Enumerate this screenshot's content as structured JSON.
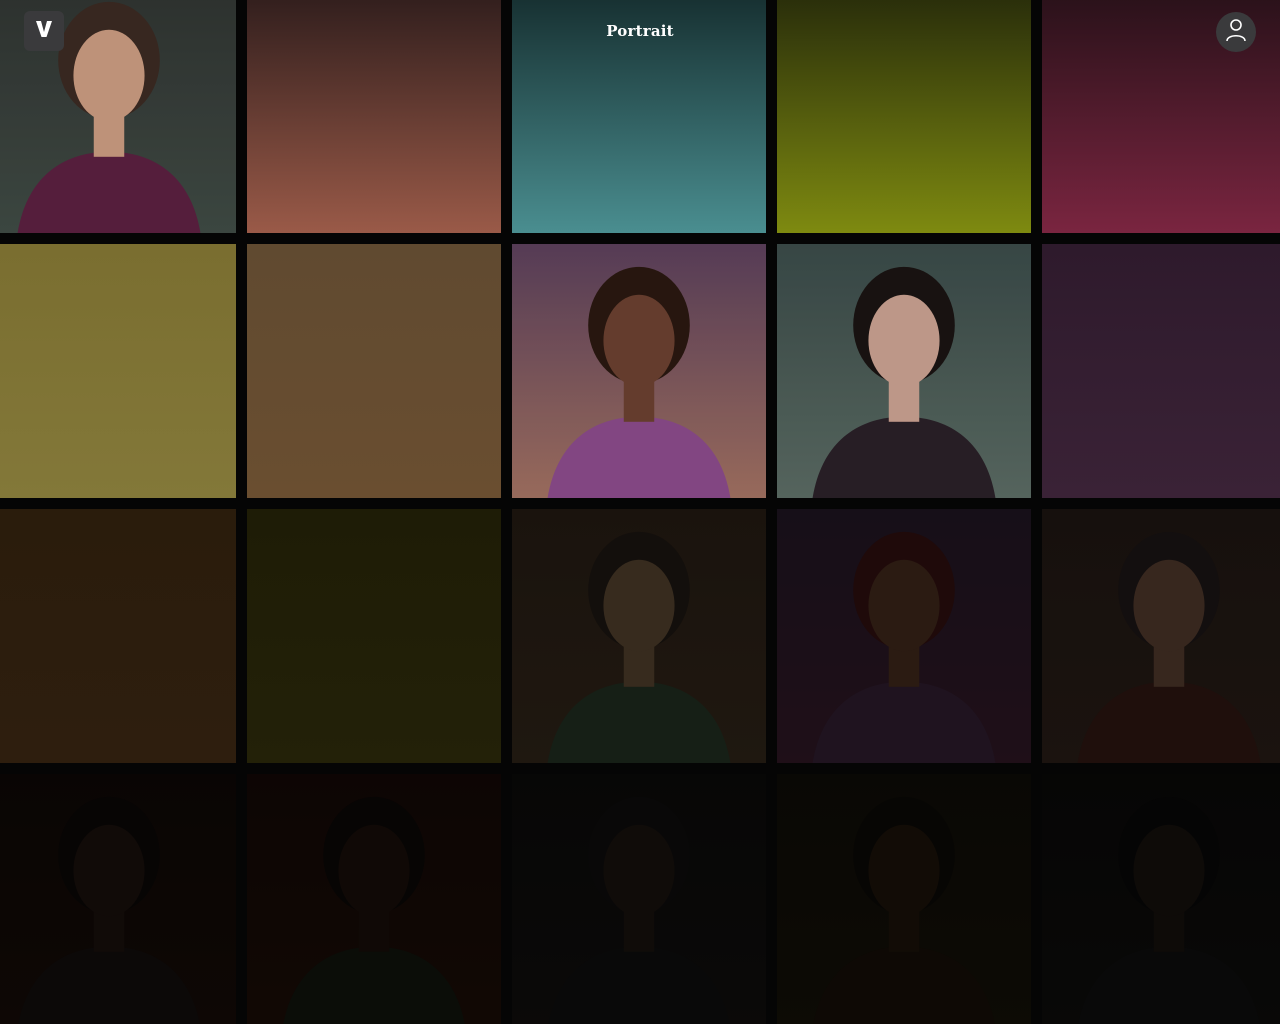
{
  "app": {
    "title": "Portrait",
    "logo_icon": "brand-v-logo-icon",
    "avatar_icon": "user-icon"
  },
  "gallery": {
    "tiles": [
      {
        "name": "portrait-woman-green",
        "kind": "portrait",
        "colors": [
          "#2f3330",
          "#3f4a44"
        ],
        "skin": "#c99a80",
        "hair": "#3a2a22",
        "cloth": "#5a2040",
        "dim": 0.05
      },
      {
        "name": "placeholder-salmon",
        "kind": "gradient",
        "colors": [
          "#2a1a1a",
          "#9a5a48"
        ],
        "dim": 0.0
      },
      {
        "name": "placeholder-teal",
        "kind": "gradient",
        "colors": [
          "#13292a",
          "#4a8e90"
        ],
        "dim": 0.0
      },
      {
        "name": "placeholder-olive",
        "kind": "gradient",
        "colors": [
          "#23270a",
          "#7e8a10"
        ],
        "dim": 0.0
      },
      {
        "name": "placeholder-crimson",
        "kind": "gradient",
        "colors": [
          "#241017",
          "#7a2540"
        ],
        "dim": 0.0
      },
      {
        "name": "placeholder-mustard",
        "kind": "gradient",
        "colors": [
          "#7a6e30",
          "#837839"
        ],
        "dim": 0.0
      },
      {
        "name": "placeholder-brown",
        "kind": "gradient",
        "colors": [
          "#604a30",
          "#6a4e30"
        ],
        "dim": 0.0
      },
      {
        "name": "portrait-hat-woman",
        "kind": "portrait",
        "colors": [
          "#5a3f5a",
          "#a07060"
        ],
        "skin": "#6a4030",
        "hair": "#2a1810",
        "cloth": "#8a4a8a",
        "dim": 0.05
      },
      {
        "name": "portrait-asian-woman",
        "kind": "portrait",
        "colors": [
          "#3a4a48",
          "#5a6a62"
        ],
        "skin": "#c8a090",
        "hair": "#1a1412",
        "cloth": "#2a2028",
        "dim": 0.05
      },
      {
        "name": "placeholder-plum",
        "kind": "gradient",
        "colors": [
          "#2e1a2c",
          "#3a2236"
        ],
        "dim": 0.0
      },
      {
        "name": "placeholder-dark-brown",
        "kind": "gradient",
        "colors": [
          "#2a1c0c",
          "#2e1e0e"
        ],
        "dim": 0.0
      },
      {
        "name": "placeholder-dark-olive",
        "kind": "gradient",
        "colors": [
          "#1e1c06",
          "#232108"
        ],
        "dim": 0.0
      },
      {
        "name": "portrait-man-glasses",
        "kind": "portrait",
        "colors": [
          "#231a12",
          "#2a2016"
        ],
        "skin": "#4a3a28",
        "hair": "#1a1410",
        "cloth": "#1e2a1e",
        "dim": 0.25
      },
      {
        "name": "portrait-man-red",
        "kind": "portrait",
        "colors": [
          "#1e1420",
          "#2a1420"
        ],
        "skin": "#3a2418",
        "hair": "#2a0e0e",
        "cloth": "#2a1a2a",
        "dim": 0.25
      },
      {
        "name": "portrait-woman-jacket",
        "kind": "portrait",
        "colors": [
          "#1e1612",
          "#241a14"
        ],
        "skin": "#4a3428",
        "hair": "#1a1414",
        "cloth": "#2a1410",
        "dim": 0.25
      },
      {
        "name": "portrait-man-dark-1",
        "kind": "portrait",
        "colors": [
          "#120a08",
          "#1a0e0a"
        ],
        "skin": "#201410",
        "hair": "#0e0a08",
        "cloth": "#161210",
        "dim": 0.45
      },
      {
        "name": "portrait-fighter-red",
        "kind": "portrait",
        "colors": [
          "#180a08",
          "#201008"
        ],
        "skin": "#1e120c",
        "hair": "#0e0a08",
        "cloth": "#141810",
        "dim": 0.45
      },
      {
        "name": "portrait-helmet",
        "kind": "portrait",
        "colors": [
          "#0e0d0c",
          "#141210"
        ],
        "skin": "#1e1612",
        "hair": "#121010",
        "cloth": "#121212",
        "dim": 0.45
      },
      {
        "name": "portrait-fighter-yellow",
        "kind": "portrait",
        "colors": [
          "#12100a",
          "#18140a"
        ],
        "skin": "#22160c",
        "hair": "#0e0c08",
        "cloth": "#1a120a",
        "dim": 0.45
      },
      {
        "name": "portrait-man-dark-2",
        "kind": "portrait",
        "colors": [
          "#0c0b0a",
          "#11100e"
        ],
        "skin": "#1a1410",
        "hair": "#0a0a0a",
        "cloth": "#121212",
        "dim": 0.45
      }
    ]
  }
}
